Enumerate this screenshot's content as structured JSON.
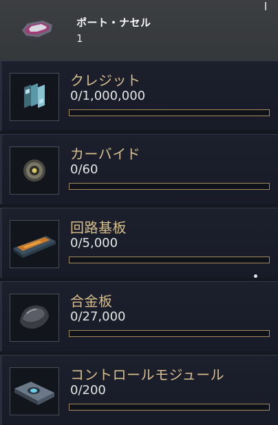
{
  "header": {
    "title": "ポート・ナセル",
    "count": "1",
    "icon": "port-nacelle-icon"
  },
  "accent_color": "#d8bf8c",
  "requirements": [
    {
      "name": "クレジット",
      "progress": "0/1,000,000",
      "fill": 0,
      "icon": "credits-icon"
    },
    {
      "name": "カーバイド",
      "progress": "0/60",
      "fill": 0,
      "icon": "carbide-icon"
    },
    {
      "name": "回路基板",
      "progress": "0/5,000",
      "fill": 0,
      "icon": "circuit-board-icon"
    },
    {
      "name": "合金板",
      "progress": "0/27,000",
      "fill": 0,
      "icon": "alloy-plate-icon"
    },
    {
      "name": "コントロールモジュール",
      "progress": "0/200",
      "fill": 0,
      "icon": "control-module-icon"
    }
  ]
}
